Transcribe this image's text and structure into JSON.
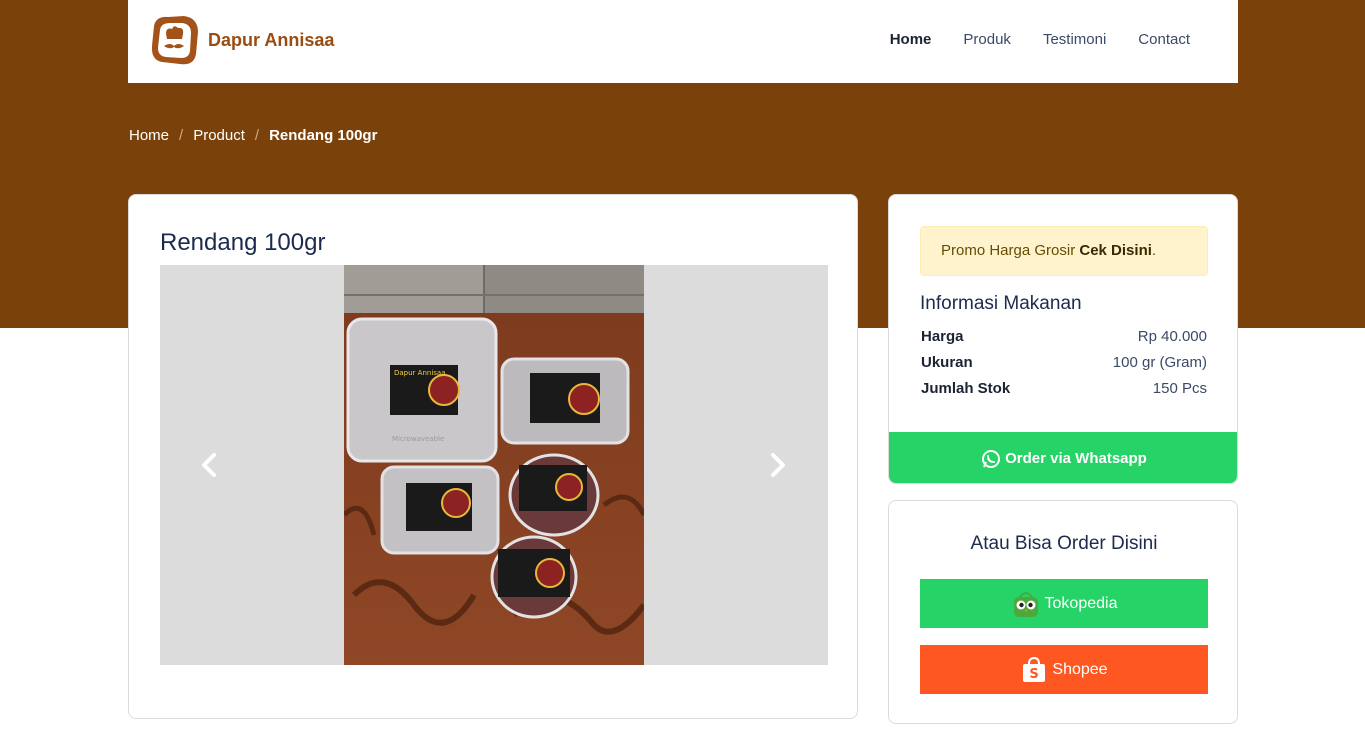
{
  "brand": {
    "name": "Dapur Annisaa"
  },
  "nav": {
    "items": [
      "Home",
      "Produk",
      "Testimoni",
      "Contact"
    ],
    "active": "Home"
  },
  "breadcrumb": {
    "home": "Home",
    "product": "Product",
    "current": "Rendang 100gr"
  },
  "product": {
    "title": "Rendang 100gr"
  },
  "promo": {
    "text": "Promo Harga Grosir ",
    "link": "Cek Disini",
    "suffix": "."
  },
  "info": {
    "title": "Informasi Makanan",
    "rows": [
      {
        "label": "Harga",
        "value": "Rp 40.000"
      },
      {
        "label": "Ukuran",
        "value": "100 gr (Gram)"
      },
      {
        "label": "Jumlah Stok",
        "value": "150 Pcs"
      }
    ]
  },
  "whatsapp": {
    "label": "Order via Whatsapp"
  },
  "order": {
    "title": "Atau Bisa Order Disini",
    "tokopedia": "Tokopedia",
    "shopee": "Shopee"
  },
  "photo_labels": {
    "brand": "Dapur Annisaa",
    "container": "Microwaveable"
  },
  "colors": {
    "hero": "#7a420a",
    "brand": "#9a4d12",
    "whatsapp": "#25d366",
    "tokopedia": "#25d366",
    "shopee": "#fe5722",
    "promo_bg": "#fff3cd"
  },
  "icons": [
    "chef-logo",
    "chevron-left-icon",
    "chevron-right-icon",
    "whatsapp-icon",
    "tokopedia-icon",
    "shopee-icon"
  ]
}
